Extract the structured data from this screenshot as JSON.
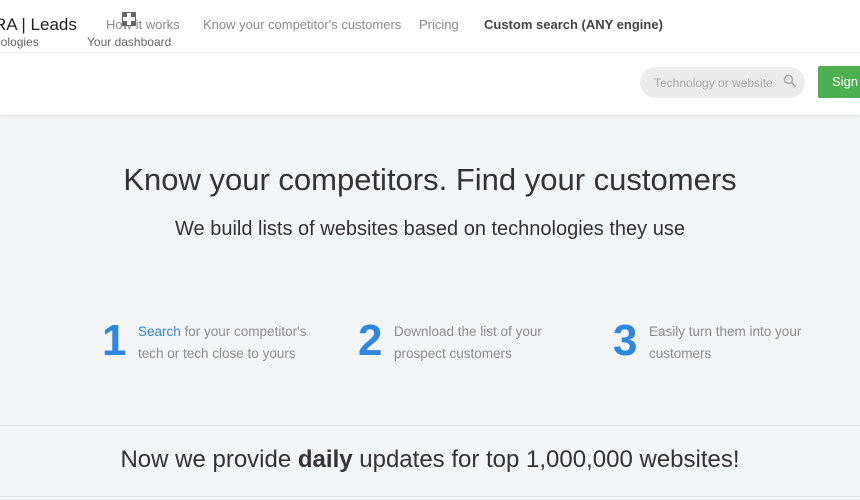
{
  "brand": "RA | Leads",
  "topnav": [
    {
      "label": "How it works"
    },
    {
      "label": "Know your competitor's customers"
    },
    {
      "label": "Pricing"
    },
    {
      "label": "Custom search (ANY engine)"
    }
  ],
  "subnav": [
    {
      "label": "nologies",
      "icon": "technologies-icon"
    },
    {
      "label": "Your dashboard",
      "icon": "dashboard-icon"
    }
  ],
  "search": {
    "placeholder": "Technology or website",
    "icon": "search-icon"
  },
  "signin_label": "Sign",
  "hero": {
    "title": "Know your competitors. Find your customers",
    "subtitle": "We build lists of websites based on technologies they use"
  },
  "steps": [
    {
      "number": "1",
      "link": "Search",
      "text": " for your competitor's tech or tech close to yours"
    },
    {
      "number": "2",
      "text": "Download the list of your prospect customers"
    },
    {
      "number": "3",
      "text": "Easily turn them into your customers"
    }
  ],
  "updates": {
    "before": "Now we provide ",
    "bold": "daily",
    "after": " updates for top 1,000,000 websites!"
  },
  "colors": {
    "accent": "#2e86de",
    "signin": "#4caf50"
  }
}
